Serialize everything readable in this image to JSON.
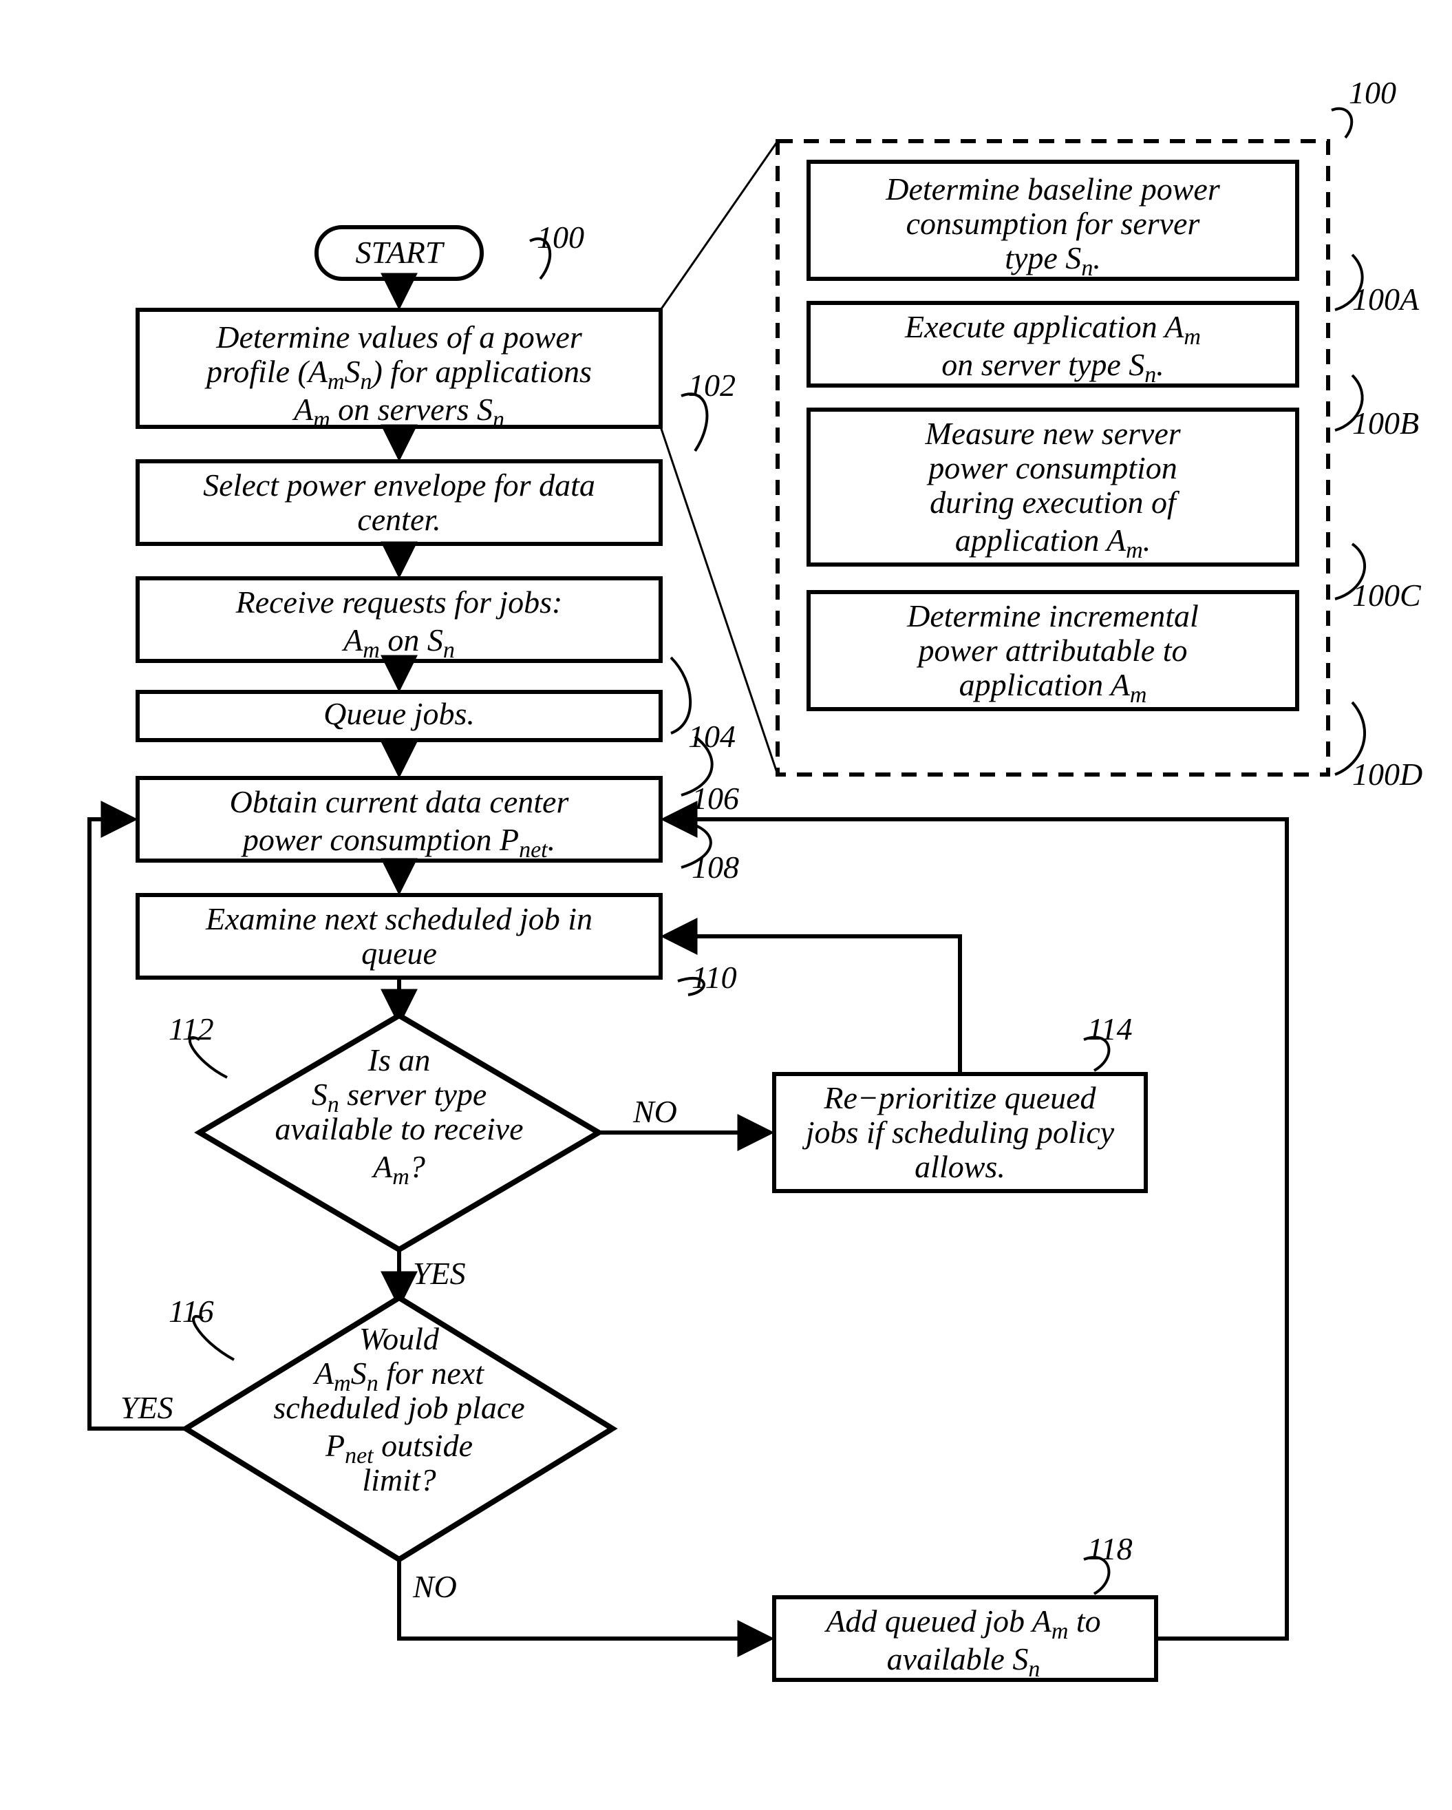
{
  "start": "START",
  "box100": {
    "l1": "Determine values of a power",
    "l2_a": "profile (A",
    "l2_b": "S",
    "l2_c": ") for applications",
    "l3_a": "A",
    "l3_b": " on servers S"
  },
  "box102": {
    "l1": "Select power envelope for data",
    "l2": "center."
  },
  "box104": {
    "l1": "Receive requests for jobs:",
    "l2_a": "A",
    "l2_b": " on S"
  },
  "box106": "Queue jobs.",
  "box108": {
    "l1": "Obtain current data center",
    "l2_a": "power consumption P",
    "l2_b": "."
  },
  "box110": {
    "l1": "Examine next scheduled job in",
    "l2": "queue"
  },
  "d112": {
    "l1": "Is an",
    "l2_a": "S",
    "l2_b": " server type",
    "l3": "available to receive",
    "l4_a": "A",
    "l4_b": "?"
  },
  "box114": {
    "l1": "Re−prioritize queued",
    "l2": "jobs if scheduling policy",
    "l3": "allows."
  },
  "d116": {
    "l1": "Would",
    "l2_a": "A",
    "l2_b": "S",
    "l2_c": " for next",
    "l3": "scheduled job place",
    "l4_a": "P",
    "l4_b": " outside",
    "l5": "limit?"
  },
  "box118": {
    "l1_a": "Add queued job A",
    "l1_b": " to",
    "l2_a": "available S"
  },
  "sub100a": {
    "l1": "Determine baseline power",
    "l2": "consumption for server",
    "l3_a": "type S",
    "l3_b": "."
  },
  "sub100b": {
    "l1_a": "Execute application A",
    "l2_a": "on server type S",
    "l2_b": "."
  },
  "sub100c": {
    "l1": "Measure new server",
    "l2": "power consumption",
    "l3": "during execution of",
    "l4_a": "application A",
    "l4_b": "."
  },
  "sub100d": {
    "l1": "Determine incremental",
    "l2": "power attributable to",
    "l3_a": "application A"
  },
  "labels": {
    "n100": "100",
    "n100a": "100A",
    "n100b": "100B",
    "n100c": "100C",
    "n100d": "100D",
    "n102": "102",
    "n104": "104",
    "n106": "106",
    "n108": "108",
    "n110": "110",
    "n112": "112",
    "n114": "114",
    "n116": "116",
    "n118": "118",
    "yes": "YES",
    "no": "NO"
  },
  "sub": {
    "m": "m",
    "n": "n",
    "net": "net"
  }
}
